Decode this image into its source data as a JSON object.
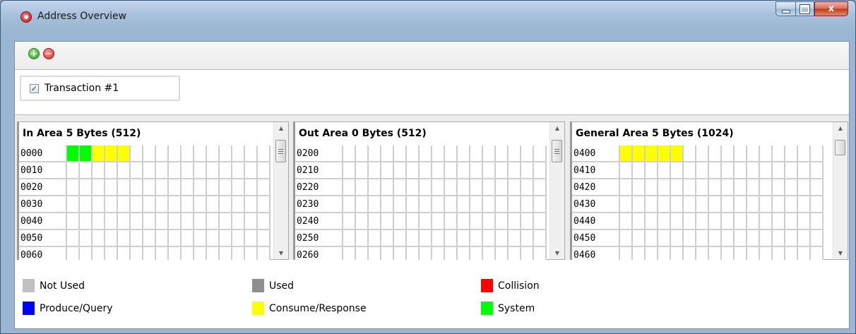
{
  "window": {
    "title": "Address Overview",
    "close_label": "x"
  },
  "toolbar": {
    "add_icon": "add-circle-icon",
    "add_glyph": "+",
    "remove_icon": "remove-circle-icon",
    "remove_glyph": "−"
  },
  "transactions": [
    {
      "label": "Transaction #1",
      "checked": true,
      "check_glyph": "✓"
    }
  ],
  "colors": {
    "not_used": "#c0c0c0",
    "used": "#8e8e8e",
    "collision": "#ff0000",
    "produce_query": "#0000ff",
    "consume_response": "#ffff00",
    "system": "#00ff00"
  },
  "panels": [
    {
      "title": "In Area 5 Bytes (512)",
      "rows": [
        {
          "addr": "0000",
          "cells": {
            "0": "system",
            "1": "system",
            "2": "consume",
            "3": "consume",
            "4": "consume"
          }
        },
        {
          "addr": "0010",
          "cells": {}
        },
        {
          "addr": "0020",
          "cells": {}
        },
        {
          "addr": "0030",
          "cells": {}
        },
        {
          "addr": "0040",
          "cells": {}
        },
        {
          "addr": "0050",
          "cells": {}
        },
        {
          "addr": "0060",
          "cells": {}
        }
      ]
    },
    {
      "title": "Out Area 0 Bytes (512)",
      "rows": [
        {
          "addr": "0200",
          "cells": {}
        },
        {
          "addr": "0210",
          "cells": {}
        },
        {
          "addr": "0220",
          "cells": {}
        },
        {
          "addr": "0230",
          "cells": {}
        },
        {
          "addr": "0240",
          "cells": {}
        },
        {
          "addr": "0250",
          "cells": {}
        },
        {
          "addr": "0260",
          "cells": {}
        }
      ]
    },
    {
      "title": "General Area 5 Bytes (1024)",
      "rows": [
        {
          "addr": "0400",
          "cells": {
            "0": "consume",
            "1": "consume",
            "2": "consume",
            "3": "consume",
            "4": "consume"
          }
        },
        {
          "addr": "0410",
          "cells": {}
        },
        {
          "addr": "0420",
          "cells": {}
        },
        {
          "addr": "0430",
          "cells": {}
        },
        {
          "addr": "0440",
          "cells": {}
        },
        {
          "addr": "0450",
          "cells": {}
        },
        {
          "addr": "0460",
          "cells": {}
        }
      ]
    }
  ],
  "legend": [
    {
      "label": "Not Used",
      "color": "#c0c0c0"
    },
    {
      "label": "Used",
      "color": "#8e8e8e"
    },
    {
      "label": "Collision",
      "color": "#ff0000"
    },
    {
      "label": "Produce/Query",
      "color": "#0000ff"
    },
    {
      "label": "Consume/Response",
      "color": "#ffff00"
    },
    {
      "label": "System",
      "color": "#00ff00"
    }
  ]
}
